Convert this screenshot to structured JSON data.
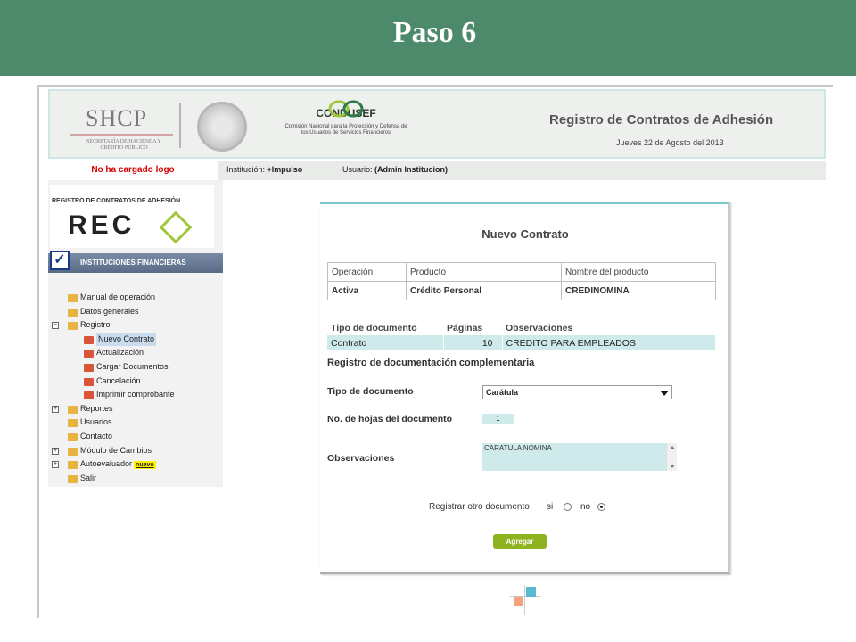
{
  "slide": {
    "title": "Paso 6"
  },
  "header": {
    "shcp_logo": "SHCP",
    "shcp_sub": "SECRETARÍA DE HACIENDA Y CRÉDITO PÚBLICO",
    "condusef_logo": "CONDUSEF",
    "condusef_sub": "Comisión Nacional para la Protección y Defensa de los Usuarios de Servicios Financieros",
    "title": "Registro de Contratos de Adhesión",
    "date": "Jueves 22 de Agosto del 2013"
  },
  "infobar": {
    "logo_status": "No ha cargado logo",
    "institucion_label": "Institución:",
    "institucion_value": "+Impulso",
    "usuario_label": "Usuario:",
    "usuario_value": "(Admin Institucion)"
  },
  "sidebar": {
    "reca_top": "REGISTRO DE CONTRATOS DE ADHESIÓN",
    "reca_big": "REC",
    "section_label": "INSTITUCIONES FINANCIERAS",
    "items": [
      {
        "label": "Manual de operación"
      },
      {
        "label": "Datos generales"
      },
      {
        "label": "Registro"
      },
      {
        "label": "Nuevo Contrato"
      },
      {
        "label": "Actualización"
      },
      {
        "label": "Cargar Documentos"
      },
      {
        "label": "Cancelación"
      },
      {
        "label": "Imprimir comprobante"
      },
      {
        "label": "Reportes"
      },
      {
        "label": "Usuarios"
      },
      {
        "label": "Contacto"
      },
      {
        "label": "Módulo de Cambios"
      },
      {
        "label": "Autoevaluador"
      },
      {
        "label": "Salir"
      }
    ],
    "nuevo_badge": "nuevo",
    "expand_open": "−",
    "expand_closed": "+"
  },
  "panel": {
    "title": "Nuevo Contrato",
    "info_headers": [
      "Operación",
      "Producto",
      "Nombre del producto"
    ],
    "info_values": [
      "Activa",
      "Crédito Personal",
      "CREDINOMINA"
    ],
    "doc_headers": [
      "Tipo de documento",
      "Páginas",
      "Observaciones"
    ],
    "doc_row": [
      "Contrato",
      "10",
      "CREDITO PARA EMPLEADOS"
    ],
    "subhead": "Registro de documentación complementaria",
    "tipo_label": "Tipo de documento",
    "tipo_value": "Carátula",
    "hojas_label": "No. de hojas del documento",
    "hojas_value": "1",
    "obs_label": "Observaciones",
    "obs_value": "CARATULA NOMINA",
    "otro_label": "Registrar otro documento",
    "si_label": "si",
    "no_label": "no",
    "agregar_label": "Agregar"
  }
}
